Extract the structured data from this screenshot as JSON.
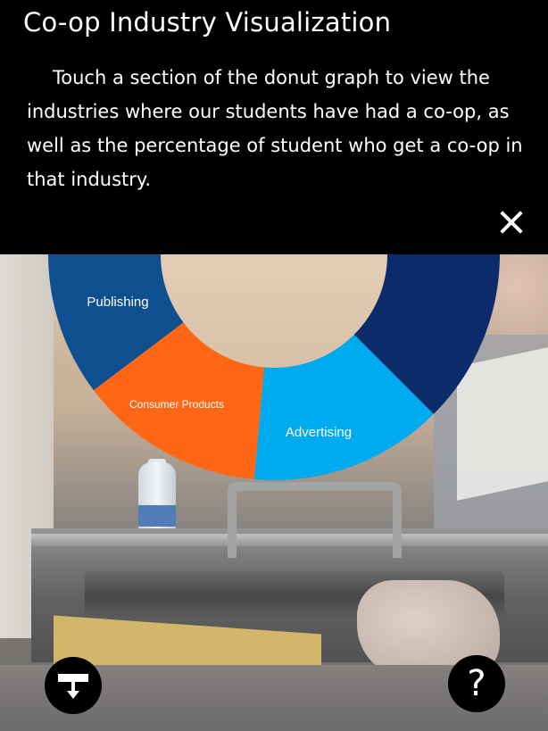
{
  "header": {
    "title": "Co-op Industry Visualization",
    "description": "Touch a section of the donut graph to view the industries where our students have had a co-op, as well as the percentage of student who get a co-op in that industry."
  },
  "icons": {
    "close": "close-icon",
    "download": "download-icon",
    "help": "help-icon"
  },
  "help_button": {
    "glyph": "?"
  },
  "colors": {
    "header_bg": "#000000",
    "advertising": "#00aaef",
    "consumer_products": "#ff6716",
    "publishing": "#0d4f8f",
    "dark_navy": "#0c2b6b",
    "green": "#8dc63f",
    "donut_center": "#e6ccb3"
  },
  "chart_data": {
    "type": "pie",
    "labels": [
      "Publishing",
      "Consumer Products",
      "Advertising"
    ],
    "colors": [
      "#0d4f8f",
      "#ff6716",
      "#00aaef"
    ],
    "other_visible_segments": [
      {
        "color": "#0c2b6b"
      },
      {
        "color": "#8dc63f"
      }
    ]
  }
}
